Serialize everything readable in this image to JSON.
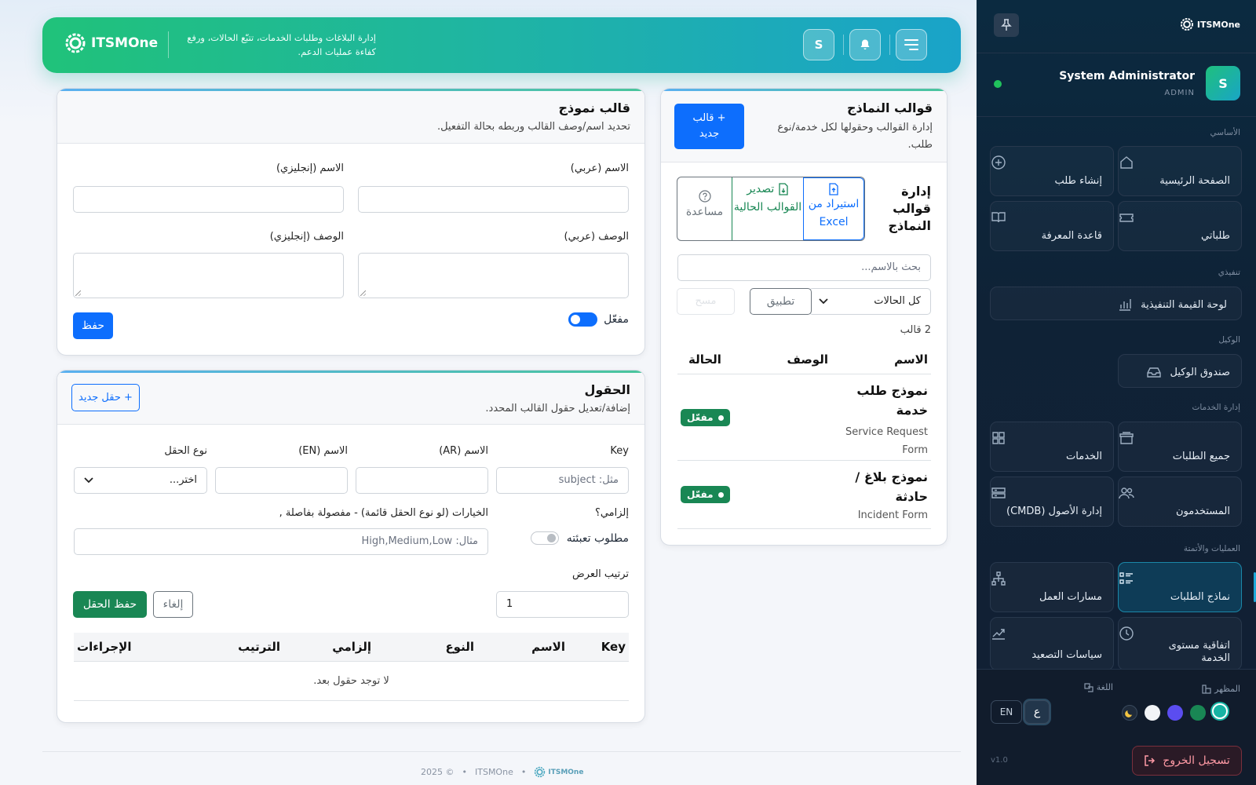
{
  "header": {
    "brand": "ITSMOne",
    "description": "إدارة البلاغات وطلبات الخدمات، تتبّع الحالات، ورفع كفاءة عمليات الدعم.",
    "avatar_letter": "S"
  },
  "list_card": {
    "title": "قوالب النماذج",
    "subtitle": "إدارة القوالب وحقولها لكل خدمة/نوع طلب.",
    "new_button": "+ قالب جديد",
    "manage_title": "إدارة قوالب النماذج",
    "import_button": "استيراد من Excel",
    "export_button": "تصدير القوالب الحالية",
    "help_button": "مساعدة",
    "search_placeholder": "بحث بالاسم...",
    "status_filter": "كل الحالات",
    "apply_button": "تطبيق",
    "clear_button": "مسح",
    "count": "2 قالب",
    "columns": [
      "الاسم",
      "الوصف",
      "الحالة"
    ],
    "rows": [
      {
        "name_ar": "نموذج طلب خدمة",
        "name_en": "Service Request Form",
        "status": "مفعّل"
      },
      {
        "name_ar": "نموذج بلاغ / حادثة",
        "name_en": "Incident Form",
        "status": "مفعّل"
      }
    ]
  },
  "template_card": {
    "title": "قالب نموذج",
    "subtitle": "تحديد اسم/وصف القالب وربطه بحالة التفعيل.",
    "name_ar_label": "الاسم (عربي)",
    "name_en_label": "الاسم (إنجليزي)",
    "desc_ar_label": "الوصف (عربي)",
    "desc_en_label": "الوصف (إنجليزي)",
    "enabled_label": "مفعّل",
    "enabled": true,
    "save_button": "حفظ"
  },
  "fields_card": {
    "title": "الحقول",
    "subtitle": "إضافة/تعديل حقول القالب المحدد.",
    "new_field_button": "+ حقل جديد",
    "key_label": "Key",
    "key_placeholder": "مثل: subject",
    "name_ar_label": "الاسم (AR)",
    "name_en_label": "الاسم (EN)",
    "type_label": "نوع الحقل",
    "type_placeholder": "اختر...",
    "required_label": "إلزامي؟",
    "required_toggle_label": "مطلوب تعبئته",
    "options_label": "الخيارات (لو نوع الحقل قائمة) - مفصولة بفاصلة ,",
    "options_placeholder": "مثال: High,Medium,Low",
    "order_label": "ترتيب العرض",
    "order_value": "1",
    "cancel_button": "إلغاء",
    "save_field_button": "حفظ الحقل",
    "columns": [
      "Key",
      "الاسم",
      "النوع",
      "إلزامي",
      "الترتيب",
      "الإجراءات"
    ],
    "empty": "لا توجد حقول بعد."
  },
  "footer": {
    "brand": "ITSMOne",
    "separator": "•",
    "year": "2025 ©"
  },
  "sidebar": {
    "brand": "ITSMOne",
    "user_name": "System Administrator",
    "user_role": "ADMIN",
    "user_letter": "S",
    "sections": {
      "basic": "الأساسي",
      "exec": "تنفيذي",
      "agent": "الوكيل",
      "services": "إدارة الخدمات",
      "ops": "العمليات والأتمتة"
    },
    "items": {
      "home": "الصفحة الرئيسية",
      "create": "إنشاء طلب",
      "my": "طلباتي",
      "kb": "قاعدة المعرفة",
      "dashboard": "لوحة القيمة التنفيذية",
      "inbox": "صندوق الوكيل",
      "all": "جميع الطلبات",
      "services": "الخدمات",
      "users": "المستخدمون",
      "cmdb": "إدارة الأصول (CMDB)",
      "forms": "نماذج الطلبات",
      "workflows": "مسارات العمل",
      "sla": "اتفاقية مستوى الخدمة",
      "escalation": "سياسات التصعيد"
    },
    "appearance_label": "المظهر",
    "language_label": "اللغة",
    "lang_ar": "ع",
    "lang_en": "EN",
    "theme_colors": [
      "#17b3a3",
      "#198754",
      "#5b4df0",
      "#f2f4f7",
      "#1e2a3a"
    ],
    "logout": "تسجيل الخروج",
    "version": "v1.0"
  }
}
